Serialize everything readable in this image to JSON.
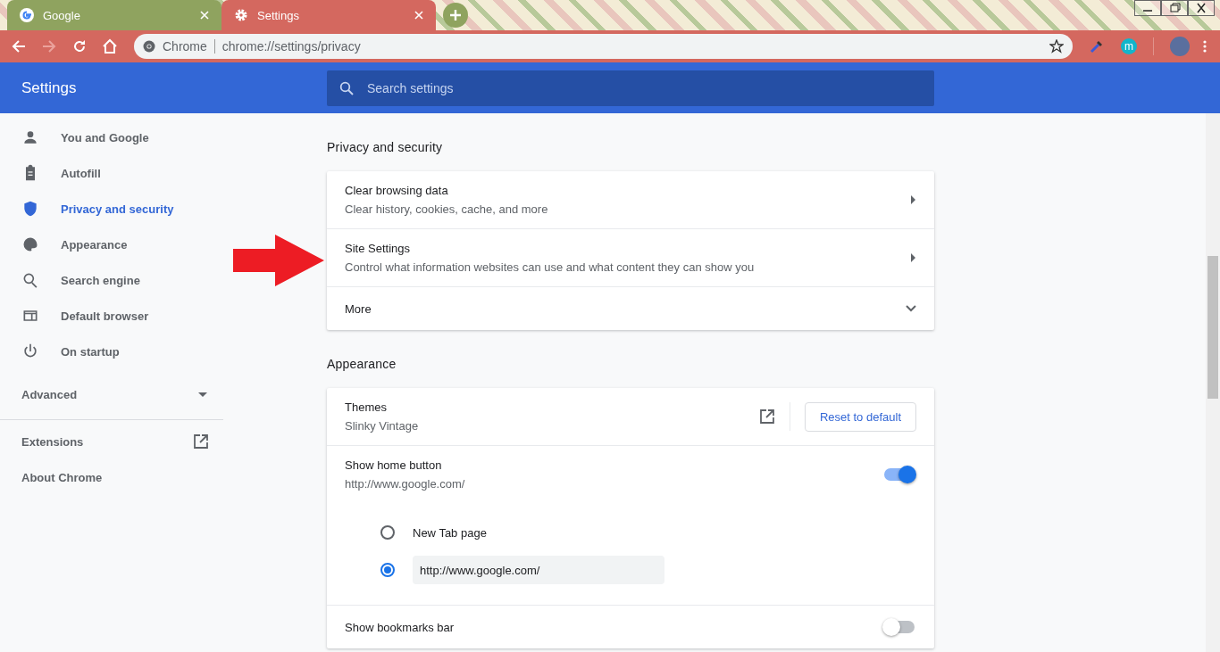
{
  "browser": {
    "tabs": [
      {
        "title": "Google",
        "selected": false
      },
      {
        "title": "Settings",
        "selected": true
      }
    ],
    "omnibox": {
      "chip": "Chrome",
      "url": "chrome://settings/privacy"
    },
    "extension_badge": "m"
  },
  "header": {
    "title": "Settings",
    "search": {
      "placeholder": "Search settings"
    }
  },
  "sidebar": {
    "items": [
      {
        "label": "You and Google",
        "selected": false
      },
      {
        "label": "Autofill",
        "selected": false
      },
      {
        "label": "Privacy and security",
        "selected": true
      },
      {
        "label": "Appearance",
        "selected": false
      },
      {
        "label": "Search engine",
        "selected": false
      },
      {
        "label": "Default browser",
        "selected": false
      },
      {
        "label": "On startup",
        "selected": false
      }
    ],
    "advanced": {
      "label": "Advanced",
      "expanded": false
    },
    "links": [
      {
        "label": "Extensions",
        "external": true
      },
      {
        "label": "About Chrome",
        "external": false
      }
    ]
  },
  "sections": [
    {
      "title": "Privacy and security",
      "rows": [
        {
          "kind": "link",
          "title": "Clear browsing data",
          "subtitle": "Clear history, cookies, cache, and more"
        },
        {
          "kind": "link",
          "title": "Site Settings",
          "subtitle": "Control what information websites can use and what content they can show you"
        },
        {
          "kind": "expand",
          "title": "More",
          "expanded": false
        }
      ]
    },
    {
      "title": "Appearance",
      "rows": [
        {
          "kind": "theme",
          "title": "Themes",
          "subtitle": "Slinky Vintage",
          "button": "Reset to default"
        },
        {
          "kind": "toggle",
          "title": "Show home button",
          "subtitle": "http://www.google.com/",
          "on": true
        },
        {
          "kind": "radios",
          "options": [
            {
              "label": "New Tab page",
              "selected": false
            },
            {
              "value": "http://www.google.com/",
              "selected": true
            }
          ]
        },
        {
          "kind": "toggle",
          "title": "Show bookmarks bar",
          "on": false
        }
      ]
    }
  ]
}
